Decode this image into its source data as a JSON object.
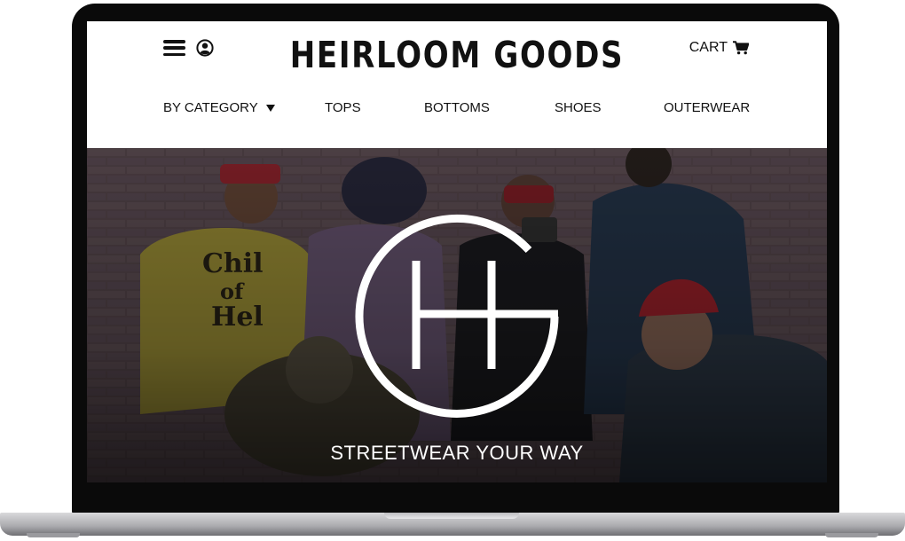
{
  "brand": {
    "name": "HEIRLOOM GOODS"
  },
  "header": {
    "cart_label": "CART"
  },
  "icons": {
    "menu": "hamburger-menu-icon",
    "account": "user-account-icon",
    "cart": "shopping-cart-icon",
    "dropdown": "caret-down-icon"
  },
  "nav": {
    "category_label": "BY CATEGORY",
    "items": [
      {
        "label": "TOPS"
      },
      {
        "label": "BOTTOMS"
      },
      {
        "label": "SHOES"
      },
      {
        "label": "OUTERWEAR"
      }
    ]
  },
  "hero": {
    "tagline": "STREETWEAR YOUR WAY"
  },
  "colors": {
    "text": "#111111",
    "overlay": "#3c3437",
    "frame": "#0a0a0a"
  }
}
